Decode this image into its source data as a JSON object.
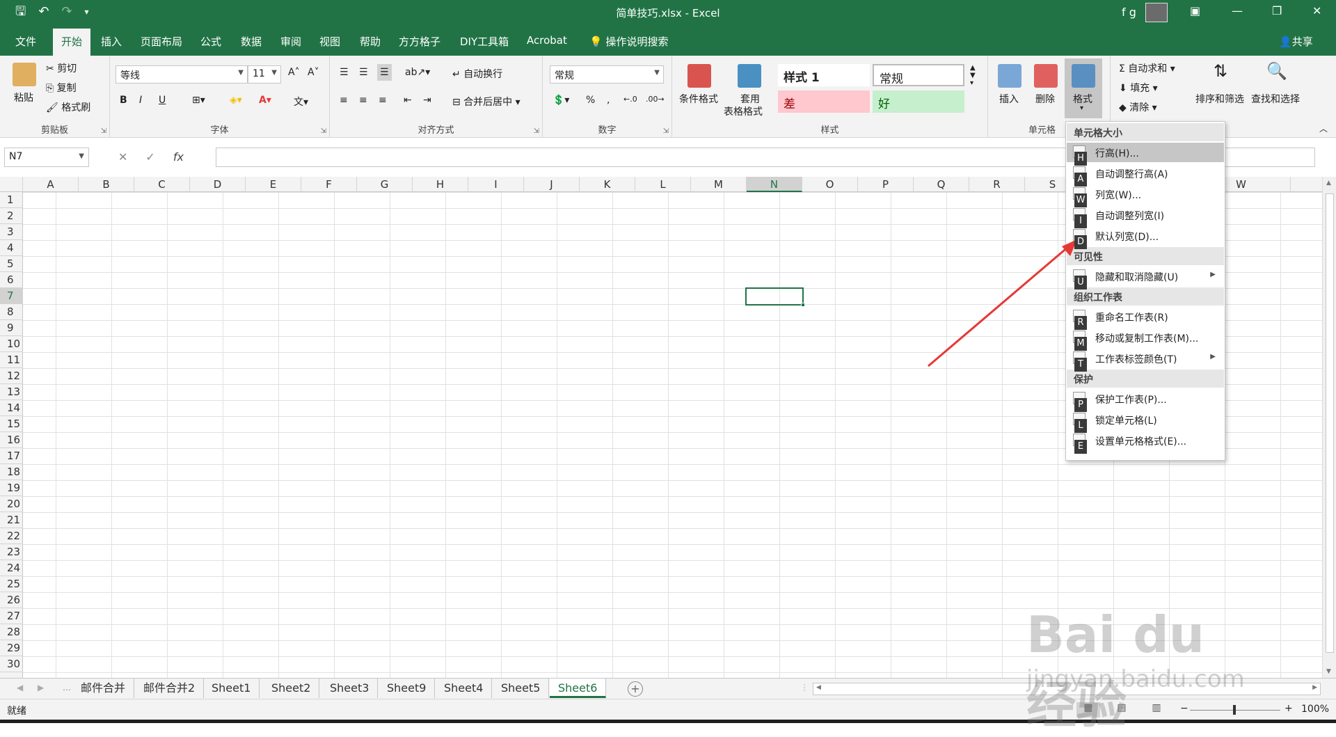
{
  "window": {
    "title": "简单技巧.xlsx  -  Excel",
    "user": "f g"
  },
  "tabs": [
    "文件",
    "开始",
    "插入",
    "页面布局",
    "公式",
    "数据",
    "审阅",
    "视图",
    "帮助",
    "方方格子",
    "DIY工具箱",
    "Acrobat"
  ],
  "active_tab": "开始",
  "search_label": "操作说明搜索",
  "share_label": "共享",
  "ribbon": {
    "clipboard": {
      "paste": "粘贴",
      "cut": "剪切",
      "copy": "复制",
      "format_painter": "格式刷",
      "label": "剪贴板"
    },
    "font": {
      "name": "等线",
      "size": "11",
      "bold": "B",
      "italic": "I",
      "underline": "U",
      "label": "字体"
    },
    "alignment": {
      "wrap": "自动换行",
      "merge": "合并后居中",
      "label": "对齐方式"
    },
    "number": {
      "format": "常规",
      "label": "数字"
    },
    "styles": {
      "conditional": "条件格式",
      "table1": "套用",
      "table2": "表格格式",
      "style1": "样式 1",
      "normal": "常规",
      "bad": "差",
      "good": "好",
      "label": "样式"
    },
    "cells": {
      "insert": "插入",
      "delete": "删除",
      "format": "格式",
      "label": "单元格"
    },
    "editing": {
      "autosum": "自动求和",
      "fill": "填充",
      "clear": "清除",
      "sort": "排序和筛选",
      "find": "查找和选择"
    }
  },
  "formula_bar": {
    "name_box": "N7",
    "fx": "fx",
    "value": ""
  },
  "columns": [
    "A",
    "B",
    "C",
    "D",
    "E",
    "F",
    "G",
    "H",
    "I",
    "J",
    "K",
    "L",
    "M",
    "N",
    "O",
    "P",
    "Q",
    "R",
    "S",
    "W"
  ],
  "rows": [
    "1",
    "2",
    "3",
    "4",
    "5",
    "6",
    "7",
    "8",
    "9",
    "10",
    "11",
    "12",
    "13",
    "14",
    "15",
    "16",
    "17",
    "18",
    "19",
    "20",
    "21",
    "22",
    "23",
    "24",
    "25",
    "26",
    "27",
    "28",
    "29",
    "30"
  ],
  "selected": {
    "col": "N",
    "row": "7"
  },
  "sheets": [
    "邮件合并",
    "邮件合并2",
    "Sheet1",
    "Sheet2",
    "Sheet3",
    "Sheet9",
    "Sheet4",
    "Sheet5",
    "Sheet6"
  ],
  "active_sheet": "Sheet6",
  "status": {
    "ready": "就绪",
    "zoom": "100%"
  },
  "menu": {
    "sections": [
      {
        "title": "单元格大小",
        "items": [
          {
            "label": "行高(H)...",
            "key": "H",
            "highlighted": true
          },
          {
            "label": "自动调整行高(A)",
            "key": "A"
          },
          {
            "label": "列宽(W)...",
            "key": "W"
          },
          {
            "label": "自动调整列宽(I)",
            "key": "I"
          },
          {
            "label": "默认列宽(D)...",
            "key": "D"
          }
        ]
      },
      {
        "title": "可见性",
        "items": [
          {
            "label": "隐藏和取消隐藏(U)",
            "key": "U",
            "submenu": true
          }
        ]
      },
      {
        "title": "组织工作表",
        "items": [
          {
            "label": "重命名工作表(R)",
            "key": "R"
          },
          {
            "label": "移动或复制工作表(M)...",
            "key": "M"
          },
          {
            "label": "工作表标签颜色(T)",
            "key": "T",
            "submenu": true
          }
        ]
      },
      {
        "title": "保护",
        "items": [
          {
            "label": "保护工作表(P)...",
            "key": "P"
          },
          {
            "label": "锁定单元格(L)",
            "key": "L"
          },
          {
            "label": "设置单元格格式(E)...",
            "key": "E"
          }
        ]
      }
    ]
  },
  "watermark": {
    "brand": "Bai du 经验",
    "url": "jingyan.baidu.com"
  },
  "colors": {
    "accent": "#217346",
    "annotation": "#e53935"
  }
}
